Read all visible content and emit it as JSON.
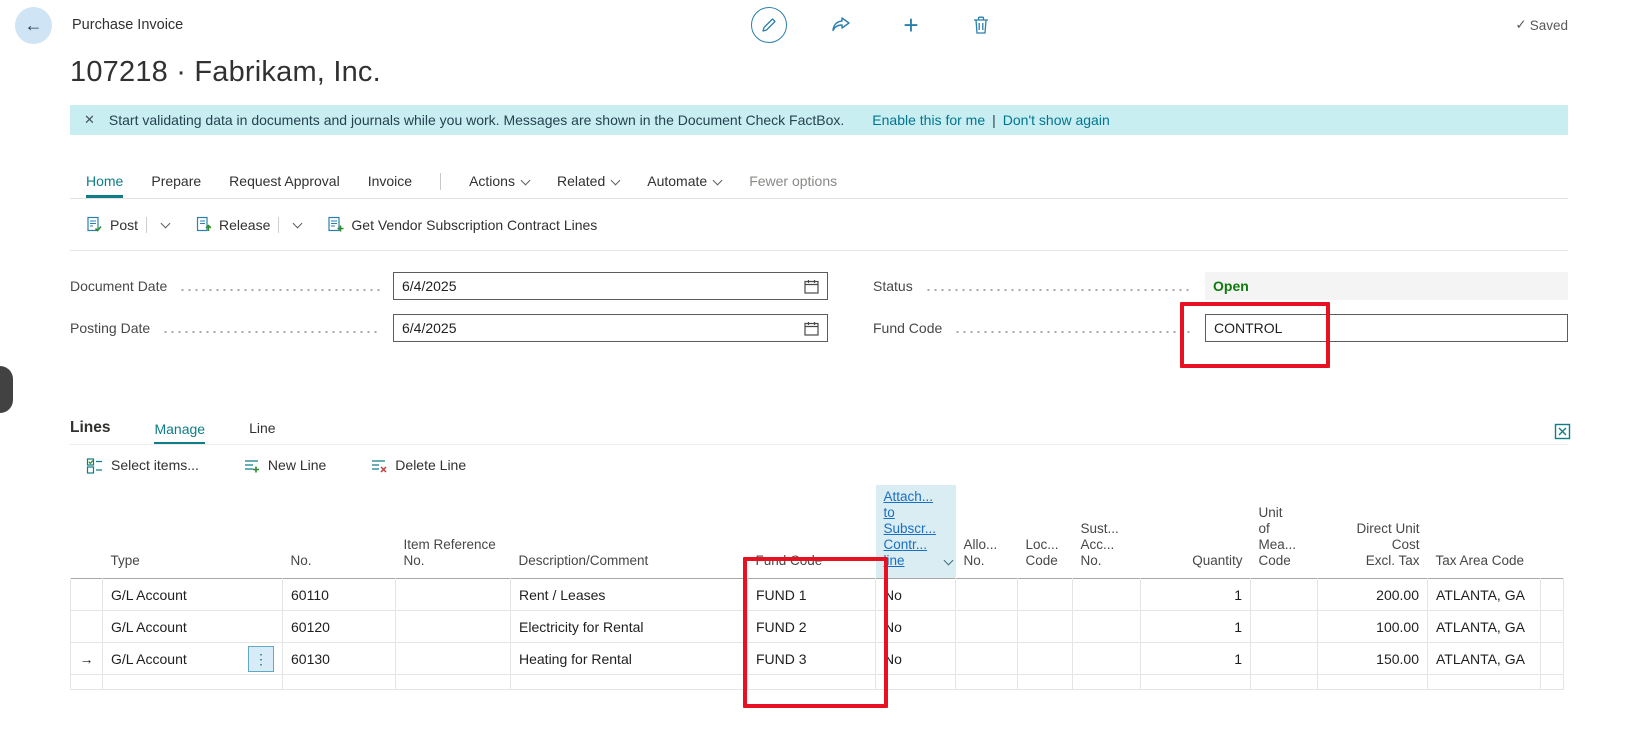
{
  "topbar": {
    "page_type": "Purchase Invoice",
    "saved": "Saved"
  },
  "page": {
    "title": "107218 · Fabrikam, Inc."
  },
  "banner": {
    "message": "Start validating data in documents and journals while you work. Messages are shown in the Document Check FactBox.",
    "action1": "Enable this for me",
    "divider": "|",
    "action2": "Don't show again"
  },
  "menu_tabs": {
    "home": "Home",
    "prepare": "Prepare",
    "request_approval": "Request Approval",
    "invoice": "Invoice",
    "actions": "Actions",
    "related": "Related",
    "automate": "Automate",
    "fewer_options": "Fewer options"
  },
  "command_bar": {
    "post": "Post",
    "release": "Release",
    "get_lines": "Get Vendor Subscription Contract Lines"
  },
  "form": {
    "document_date_label": "Document Date",
    "document_date_value": "6/4/2025",
    "posting_date_label": "Posting Date",
    "posting_date_value": "6/4/2025",
    "status_label": "Status",
    "status_value": "Open",
    "fund_code_label": "Fund Code",
    "fund_code_value": "CONTROL"
  },
  "lines": {
    "title": "Lines",
    "tab_manage": "Manage",
    "tab_line": "Line",
    "toolbar": {
      "select_items": "Select items...",
      "new_line": "New Line",
      "delete_line": "Delete Line"
    },
    "columns": {
      "type": "Type",
      "no": "No.",
      "item_ref": "Item Reference\nNo.",
      "description": "Description/Comment",
      "fund_code": "Fund Code",
      "attach": "Attach...\nto\nSubscr...\nContr...\nline",
      "allo": "Allo...\nNo.",
      "loc": "Loc...\nCode",
      "sust": "Sust...\nAcc...\nNo.",
      "quantity": "Quantity",
      "uom": "Unit\nof\nMea...\nCode",
      "direct_cost": "Direct Unit Cost\nExcl. Tax",
      "tax_area": "Tax Area Code"
    },
    "rows": [
      {
        "cells": [
          "G/L Account",
          "60110",
          "",
          "Rent / Leases",
          "FUND 1",
          "No",
          "",
          "",
          "",
          "1",
          "",
          "200.00",
          "ATLANTA, GA"
        ]
      },
      {
        "cells": [
          "G/L Account",
          "60120",
          "",
          "Electricity for Rental",
          "FUND 2",
          "No",
          "",
          "",
          "",
          "1",
          "",
          "100.00",
          "ATLANTA, GA"
        ]
      },
      {
        "cells": [
          "G/L Account",
          "60130",
          "",
          "Heating for Rental",
          "FUND 3",
          "No",
          "",
          "",
          "",
          "1",
          "",
          "150.00",
          "ATLANTA, GA"
        ]
      }
    ]
  },
  "icons": {
    "back": "←",
    "edit": "pencil",
    "share": "share-arrow",
    "add": "+",
    "delete": "trash-can",
    "saved_check": "✓",
    "close": "✕",
    "calendar": "calendar-grid",
    "chevron": "chevron-down",
    "row_pointer": "→",
    "more": "⋮"
  },
  "colors": {
    "accent_teal": "#0d7d87",
    "icon_blue": "#2b7fad",
    "link_blue": "#1a6fc4",
    "status_green": "#0e7a0e",
    "annotation_red": "#e81123",
    "banner_bg": "#c9eef2"
  }
}
